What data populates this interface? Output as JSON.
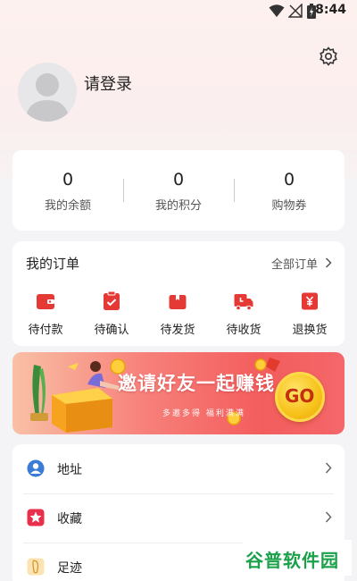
{
  "status_bar": {
    "time": "8:44",
    "icons": [
      "wifi-icon",
      "signal-icon",
      "battery-icon"
    ]
  },
  "profile": {
    "login_text": "请登录",
    "avatar_icon": "avatar-icon",
    "settings_icon": "gear-icon"
  },
  "stats": [
    {
      "value": "0",
      "label": "我的余额"
    },
    {
      "value": "0",
      "label": "我的积分"
    },
    {
      "value": "0",
      "label": "购物券"
    }
  ],
  "orders": {
    "title": "我的订单",
    "all_label": "全部订单",
    "items": [
      {
        "label": "待付款",
        "icon": "wallet-icon"
      },
      {
        "label": "待确认",
        "icon": "checklist-icon"
      },
      {
        "label": "待发货",
        "icon": "package-icon"
      },
      {
        "label": "待收货",
        "icon": "delivery-truck-icon"
      },
      {
        "label": "退换货",
        "icon": "yen-refund-icon"
      }
    ]
  },
  "banner": {
    "title": "邀请好友一起赚钱",
    "subtitle": "多邀多得 福利满满",
    "go_label": "GO"
  },
  "menu": [
    {
      "label": "地址",
      "icon": "location-person-icon"
    },
    {
      "label": "收藏",
      "icon": "star-icon"
    },
    {
      "label": "足迹",
      "icon": "footprint-icon"
    }
  ],
  "watermark": {
    "text": "谷普软件园"
  },
  "colors": {
    "accent": "#e53935",
    "background": "#f4f4f6",
    "watermark": "#1aa14a"
  }
}
